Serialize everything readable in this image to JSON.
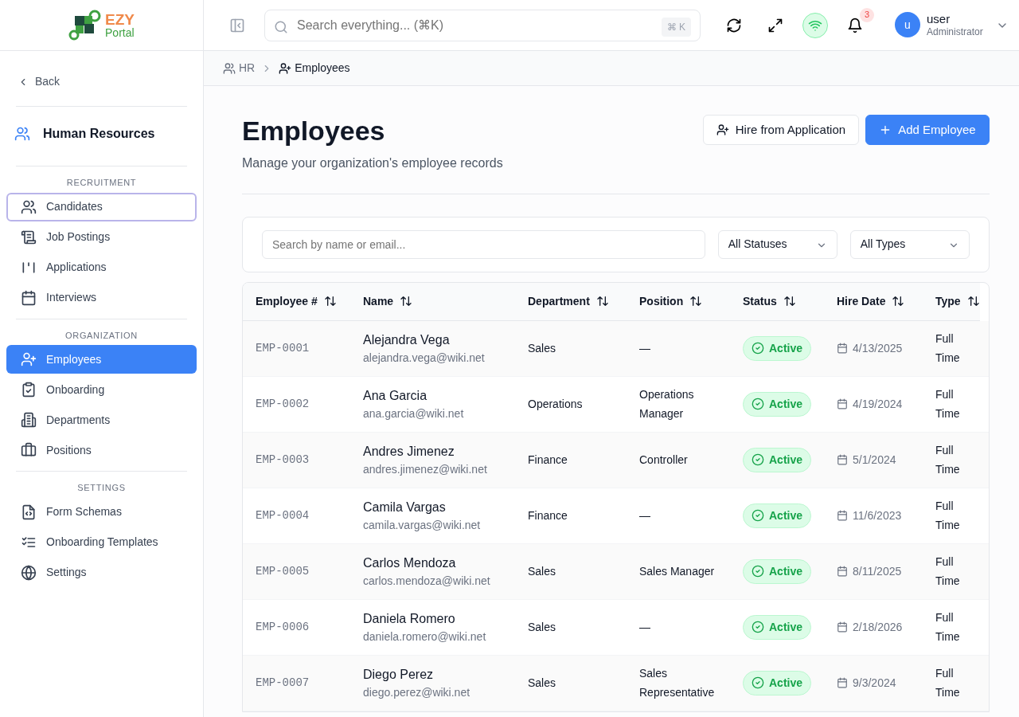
{
  "logo": {
    "word1": "EZY",
    "word2": "Portal"
  },
  "topbar": {
    "search_placeholder": "Search everything... (⌘K)",
    "shortcut": "⌘ K",
    "notifications": "3",
    "user": {
      "initial": "u",
      "name": "user",
      "role": "Administrator"
    }
  },
  "breadcrumb": [
    {
      "label": "HR",
      "current": false
    },
    {
      "label": "Employees",
      "current": true
    }
  ],
  "sidebar": {
    "back": "Back",
    "module": "Human Resources",
    "sections": [
      {
        "heading": "RECRUITMENT",
        "items": [
          {
            "label": "Candidates",
            "selected": false,
            "focused": true
          },
          {
            "label": "Job Postings",
            "selected": false,
            "focused": false
          },
          {
            "label": "Applications",
            "selected": false,
            "focused": false
          },
          {
            "label": "Interviews",
            "selected": false,
            "focused": false
          }
        ]
      },
      {
        "heading": "ORGANIZATION",
        "items": [
          {
            "label": "Employees",
            "selected": true,
            "focused": false
          },
          {
            "label": "Onboarding",
            "selected": false,
            "focused": false
          },
          {
            "label": "Departments",
            "selected": false,
            "focused": false
          },
          {
            "label": "Positions",
            "selected": false,
            "focused": false
          }
        ]
      },
      {
        "heading": "SETTINGS",
        "items": [
          {
            "label": "Form Schemas",
            "selected": false,
            "focused": false
          },
          {
            "label": "Onboarding Templates",
            "selected": false,
            "focused": false
          },
          {
            "label": "Settings",
            "selected": false,
            "focused": false
          }
        ]
      }
    ]
  },
  "page": {
    "title": "Employees",
    "subtitle": "Manage your organization's employee records",
    "buttons": [
      {
        "label": "Hire from Application",
        "kind": "outline"
      },
      {
        "label": "Add Employee",
        "kind": "primary"
      }
    ]
  },
  "filters": {
    "search_placeholder": "Search by name or email...",
    "selects": [
      "All Statuses",
      "All Types"
    ]
  },
  "table": {
    "columns": [
      "Employee #",
      "Name",
      "Department",
      "Position",
      "Status",
      "Hire Date",
      "Type"
    ],
    "rows": [
      {
        "id": "EMP-0001",
        "name": "Alejandra Vega",
        "email": "alejandra.vega@wiki.net",
        "department": "Sales",
        "position": "—",
        "status": "Active",
        "hire_date": "4/13/2025",
        "type": "Full Time"
      },
      {
        "id": "EMP-0002",
        "name": "Ana Garcia",
        "email": "ana.garcia@wiki.net",
        "department": "Operations",
        "position": "Operations Manager",
        "status": "Active",
        "hire_date": "4/19/2024",
        "type": "Full Time"
      },
      {
        "id": "EMP-0003",
        "name": "Andres Jimenez",
        "email": "andres.jimenez@wiki.net",
        "department": "Finance",
        "position": "Controller",
        "status": "Active",
        "hire_date": "5/1/2024",
        "type": "Full Time"
      },
      {
        "id": "EMP-0004",
        "name": "Camila Vargas",
        "email": "camila.vargas@wiki.net",
        "department": "Finance",
        "position": "—",
        "status": "Active",
        "hire_date": "11/6/2023",
        "type": "Full Time"
      },
      {
        "id": "EMP-0005",
        "name": "Carlos Mendoza",
        "email": "carlos.mendoza@wiki.net",
        "department": "Sales",
        "position": "Sales Manager",
        "status": "Active",
        "hire_date": "8/11/2025",
        "type": "Full Time"
      },
      {
        "id": "EMP-0006",
        "name": "Daniela Romero",
        "email": "daniela.romero@wiki.net",
        "department": "Sales",
        "position": "—",
        "status": "Active",
        "hire_date": "2/18/2026",
        "type": "Full Time"
      },
      {
        "id": "EMP-0007",
        "name": "Diego Perez",
        "email": "diego.perez@wiki.net",
        "department": "Sales",
        "position": "Sales Representative",
        "status": "Active",
        "hire_date": "9/3/2024",
        "type": "Full Time"
      }
    ]
  }
}
